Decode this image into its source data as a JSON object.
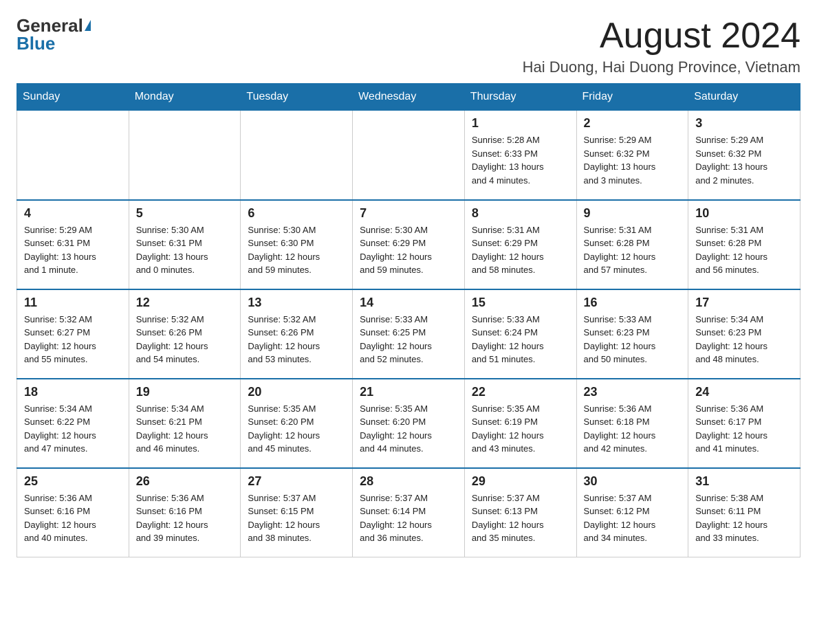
{
  "logo": {
    "general": "General",
    "blue": "Blue"
  },
  "title": "August 2024",
  "location": "Hai Duong, Hai Duong Province, Vietnam",
  "weekdays": [
    "Sunday",
    "Monday",
    "Tuesday",
    "Wednesday",
    "Thursday",
    "Friday",
    "Saturday"
  ],
  "weeks": [
    [
      {
        "day": "",
        "info": ""
      },
      {
        "day": "",
        "info": ""
      },
      {
        "day": "",
        "info": ""
      },
      {
        "day": "",
        "info": ""
      },
      {
        "day": "1",
        "info": "Sunrise: 5:28 AM\nSunset: 6:33 PM\nDaylight: 13 hours\nand 4 minutes."
      },
      {
        "day": "2",
        "info": "Sunrise: 5:29 AM\nSunset: 6:32 PM\nDaylight: 13 hours\nand 3 minutes."
      },
      {
        "day": "3",
        "info": "Sunrise: 5:29 AM\nSunset: 6:32 PM\nDaylight: 13 hours\nand 2 minutes."
      }
    ],
    [
      {
        "day": "4",
        "info": "Sunrise: 5:29 AM\nSunset: 6:31 PM\nDaylight: 13 hours\nand 1 minute."
      },
      {
        "day": "5",
        "info": "Sunrise: 5:30 AM\nSunset: 6:31 PM\nDaylight: 13 hours\nand 0 minutes."
      },
      {
        "day": "6",
        "info": "Sunrise: 5:30 AM\nSunset: 6:30 PM\nDaylight: 12 hours\nand 59 minutes."
      },
      {
        "day": "7",
        "info": "Sunrise: 5:30 AM\nSunset: 6:29 PM\nDaylight: 12 hours\nand 59 minutes."
      },
      {
        "day": "8",
        "info": "Sunrise: 5:31 AM\nSunset: 6:29 PM\nDaylight: 12 hours\nand 58 minutes."
      },
      {
        "day": "9",
        "info": "Sunrise: 5:31 AM\nSunset: 6:28 PM\nDaylight: 12 hours\nand 57 minutes."
      },
      {
        "day": "10",
        "info": "Sunrise: 5:31 AM\nSunset: 6:28 PM\nDaylight: 12 hours\nand 56 minutes."
      }
    ],
    [
      {
        "day": "11",
        "info": "Sunrise: 5:32 AM\nSunset: 6:27 PM\nDaylight: 12 hours\nand 55 minutes."
      },
      {
        "day": "12",
        "info": "Sunrise: 5:32 AM\nSunset: 6:26 PM\nDaylight: 12 hours\nand 54 minutes."
      },
      {
        "day": "13",
        "info": "Sunrise: 5:32 AM\nSunset: 6:26 PM\nDaylight: 12 hours\nand 53 minutes."
      },
      {
        "day": "14",
        "info": "Sunrise: 5:33 AM\nSunset: 6:25 PM\nDaylight: 12 hours\nand 52 minutes."
      },
      {
        "day": "15",
        "info": "Sunrise: 5:33 AM\nSunset: 6:24 PM\nDaylight: 12 hours\nand 51 minutes."
      },
      {
        "day": "16",
        "info": "Sunrise: 5:33 AM\nSunset: 6:23 PM\nDaylight: 12 hours\nand 50 minutes."
      },
      {
        "day": "17",
        "info": "Sunrise: 5:34 AM\nSunset: 6:23 PM\nDaylight: 12 hours\nand 48 minutes."
      }
    ],
    [
      {
        "day": "18",
        "info": "Sunrise: 5:34 AM\nSunset: 6:22 PM\nDaylight: 12 hours\nand 47 minutes."
      },
      {
        "day": "19",
        "info": "Sunrise: 5:34 AM\nSunset: 6:21 PM\nDaylight: 12 hours\nand 46 minutes."
      },
      {
        "day": "20",
        "info": "Sunrise: 5:35 AM\nSunset: 6:20 PM\nDaylight: 12 hours\nand 45 minutes."
      },
      {
        "day": "21",
        "info": "Sunrise: 5:35 AM\nSunset: 6:20 PM\nDaylight: 12 hours\nand 44 minutes."
      },
      {
        "day": "22",
        "info": "Sunrise: 5:35 AM\nSunset: 6:19 PM\nDaylight: 12 hours\nand 43 minutes."
      },
      {
        "day": "23",
        "info": "Sunrise: 5:36 AM\nSunset: 6:18 PM\nDaylight: 12 hours\nand 42 minutes."
      },
      {
        "day": "24",
        "info": "Sunrise: 5:36 AM\nSunset: 6:17 PM\nDaylight: 12 hours\nand 41 minutes."
      }
    ],
    [
      {
        "day": "25",
        "info": "Sunrise: 5:36 AM\nSunset: 6:16 PM\nDaylight: 12 hours\nand 40 minutes."
      },
      {
        "day": "26",
        "info": "Sunrise: 5:36 AM\nSunset: 6:16 PM\nDaylight: 12 hours\nand 39 minutes."
      },
      {
        "day": "27",
        "info": "Sunrise: 5:37 AM\nSunset: 6:15 PM\nDaylight: 12 hours\nand 38 minutes."
      },
      {
        "day": "28",
        "info": "Sunrise: 5:37 AM\nSunset: 6:14 PM\nDaylight: 12 hours\nand 36 minutes."
      },
      {
        "day": "29",
        "info": "Sunrise: 5:37 AM\nSunset: 6:13 PM\nDaylight: 12 hours\nand 35 minutes."
      },
      {
        "day": "30",
        "info": "Sunrise: 5:37 AM\nSunset: 6:12 PM\nDaylight: 12 hours\nand 34 minutes."
      },
      {
        "day": "31",
        "info": "Sunrise: 5:38 AM\nSunset: 6:11 PM\nDaylight: 12 hours\nand 33 minutes."
      }
    ]
  ]
}
